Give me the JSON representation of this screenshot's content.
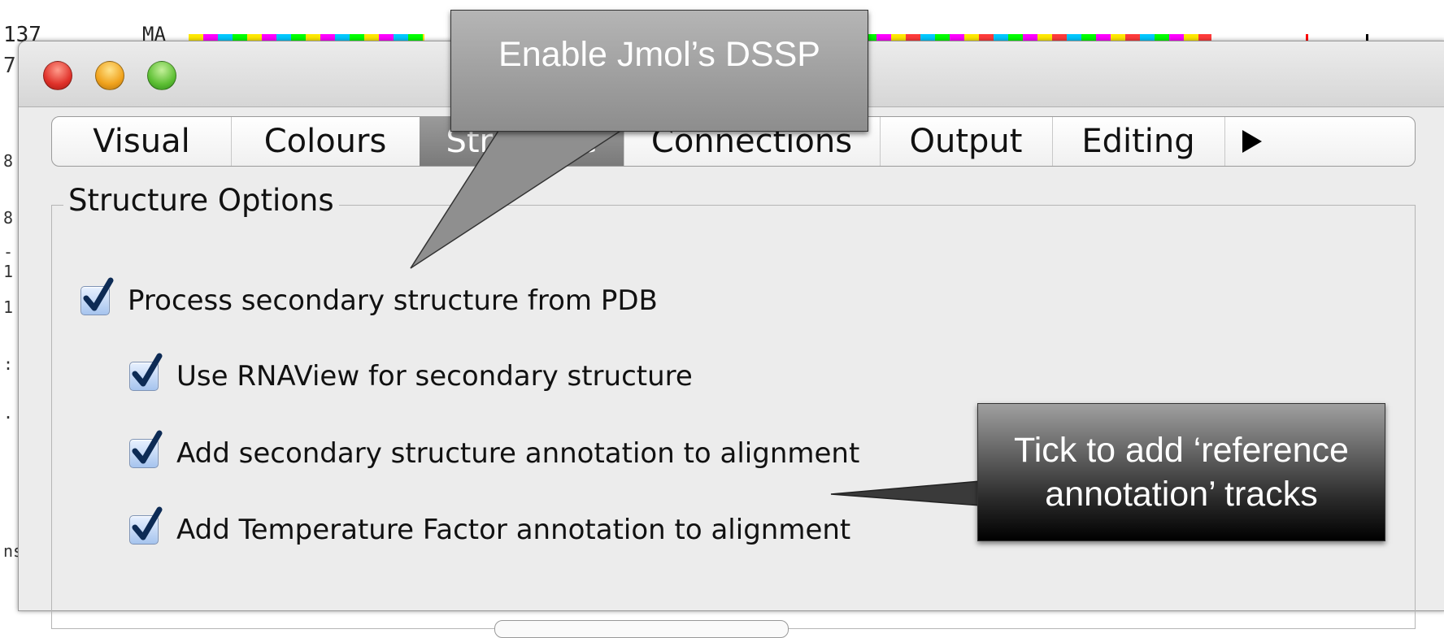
{
  "background": {
    "line_numbers_top": [
      "137",
      "7"
    ],
    "gutter_chars": [
      "8",
      "8",
      "-",
      "1",
      "1",
      ":",
      ".",
      "ns"
    ],
    "sequence_prefix": "MA"
  },
  "window": {
    "tabs": [
      "Visual",
      "Colours",
      "Structure",
      "Connections",
      "Output",
      "Editing"
    ],
    "selected_tab": "Structure",
    "more_tabs_icon": "arrow-right-icon"
  },
  "group": {
    "title": "Structure Options"
  },
  "options": {
    "pdb": {
      "label": "Process secondary structure from PDB",
      "checked": true
    },
    "rnaview": {
      "label": "Use RNAView for secondary structure",
      "checked": true
    },
    "ss_annotation": {
      "label": "Add secondary structure annotation to alignment",
      "checked": true
    },
    "temp_annotation": {
      "label": "Add Temperature Factor annotation to alignment",
      "checked": true
    }
  },
  "callouts": {
    "dssp": "Enable Jmol’s DSSP",
    "reference": "Tick to add ‘reference annotation’ tracks"
  },
  "colors": {
    "callout_gray": "#9d9d9d",
    "selected_tab": "#8a8a8a",
    "checkbox_blue": "#a6c4ee",
    "window_bg": "#ececec"
  }
}
